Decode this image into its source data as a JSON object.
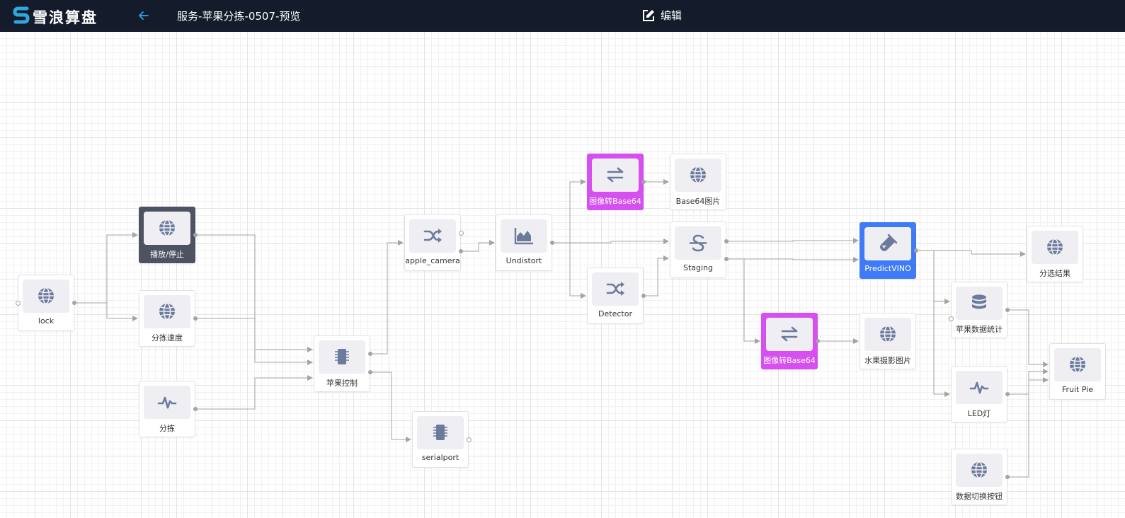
{
  "app": {
    "logo_text": "雪浪算盘"
  },
  "header": {
    "title": "服务-苹果分拣-0507-预览",
    "edit_label": "编辑"
  },
  "colors": {
    "topbar": "#141c2c",
    "dark_node": "#4e5362",
    "magenta_node": "#d64ff0",
    "blue_node": "#3f7bf5",
    "icon": "#6c7a9c",
    "edge": "#a4a4a4"
  },
  "nodes": [
    {
      "id": "lock",
      "label": "lock",
      "icon": "globe-icon",
      "style": "normal"
    },
    {
      "id": "play",
      "label": "播放/停止",
      "icon": "globe-icon",
      "style": "dark"
    },
    {
      "id": "speed",
      "label": "分拣速度",
      "icon": "globe-icon",
      "style": "normal"
    },
    {
      "id": "sort",
      "label": "分拣",
      "icon": "waveform-icon",
      "style": "normal"
    },
    {
      "id": "ctrl",
      "label": "苹果控制",
      "icon": "chip-icon",
      "style": "normal"
    },
    {
      "id": "camera",
      "label": "apple_camera",
      "icon": "shuffle-icon",
      "style": "normal"
    },
    {
      "id": "serial",
      "label": "serialport",
      "icon": "chip-icon",
      "style": "normal"
    },
    {
      "id": "undistort",
      "label": "Undistort",
      "icon": "area-chart-icon",
      "style": "normal"
    },
    {
      "id": "b64a",
      "label": "图像转Base64",
      "icon": "exchange-icon",
      "style": "magenta"
    },
    {
      "id": "detector",
      "label": "Detector",
      "icon": "shuffle-icon",
      "style": "normal"
    },
    {
      "id": "b64img",
      "label": "Base64图片",
      "icon": "globe-icon",
      "style": "normal"
    },
    {
      "id": "staging",
      "label": "Staging",
      "icon": "strikethrough-icon",
      "style": "normal"
    },
    {
      "id": "b64b",
      "label": "图像转Base64",
      "icon": "exchange-icon",
      "style": "magenta"
    },
    {
      "id": "predict",
      "label": "PredictVINO",
      "icon": "flask-icon",
      "style": "blue"
    },
    {
      "id": "fruitimg",
      "label": "水果摄影图片",
      "icon": "globe-icon",
      "style": "normal"
    },
    {
      "id": "result",
      "label": "分选结果",
      "icon": "globe-icon",
      "style": "normal"
    },
    {
      "id": "stats",
      "label": "苹果数据统计",
      "icon": "database-icon",
      "style": "normal"
    },
    {
      "id": "led",
      "label": "LED灯",
      "icon": "waveform-icon",
      "style": "normal"
    },
    {
      "id": "switchbtn",
      "label": "数据切换按钮",
      "icon": "globe-icon",
      "style": "normal"
    },
    {
      "id": "pie",
      "label": "Fruit Pie",
      "icon": "globe-icon",
      "style": "normal"
    }
  ]
}
